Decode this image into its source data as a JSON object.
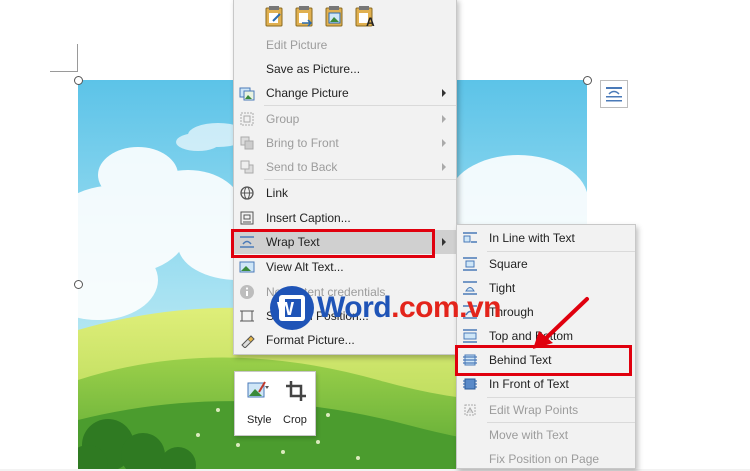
{
  "context_menu": {
    "paste_options": [
      "keep-source-formatting-paste-icon",
      "merge-formatting-paste-icon",
      "picture-paste-icon",
      "keep-text-only-paste-icon"
    ],
    "items": [
      {
        "label": "Edit Picture",
        "enabled": false
      },
      {
        "label": "Save as Picture...",
        "enabled": true
      },
      {
        "label": "Change Picture",
        "enabled": true,
        "submenu": true
      },
      {
        "label": "Group",
        "enabled": false,
        "submenu": true
      },
      {
        "label": "Bring to Front",
        "enabled": false,
        "submenu": true
      },
      {
        "label": "Send to Back",
        "enabled": false,
        "submenu": true
      },
      {
        "label": "Link",
        "enabled": true
      },
      {
        "label": "Insert Caption...",
        "enabled": true
      },
      {
        "label": "Wrap Text",
        "enabled": true,
        "submenu": true,
        "highlighted": true
      },
      {
        "label": "View Alt Text...",
        "enabled": true
      },
      {
        "label": "No content credentials",
        "enabled": false
      },
      {
        "label": "Size and Position...",
        "enabled": true
      },
      {
        "label": "Format Picture...",
        "enabled": true
      }
    ]
  },
  "wrap_submenu": {
    "items": [
      {
        "label": "In Line with Text",
        "enabled": true
      },
      {
        "label": "Square",
        "enabled": true
      },
      {
        "label": "Tight",
        "enabled": true
      },
      {
        "label": "Through",
        "enabled": true
      },
      {
        "label": "Top and Bottom",
        "enabled": true
      },
      {
        "label": "Behind Text",
        "enabled": true,
        "highlighted": true
      },
      {
        "label": "In Front of Text",
        "enabled": true
      },
      {
        "label": "Edit Wrap Points",
        "enabled": false
      },
      {
        "label": "Move with Text",
        "enabled": false
      },
      {
        "label": "Fix Position on Page",
        "enabled": false
      }
    ]
  },
  "mini_toolbar": {
    "style_label": "Style",
    "crop_label": "Crop"
  },
  "watermark": {
    "text_main": "Word",
    "text_suffix": ".com.vn",
    "icon_letter": "W"
  },
  "colors": {
    "highlight_red": "#e0000e",
    "menu_bg": "#f2f2f2",
    "watermark_blue": "#1f54b7",
    "watermark_red": "#e3241b"
  }
}
